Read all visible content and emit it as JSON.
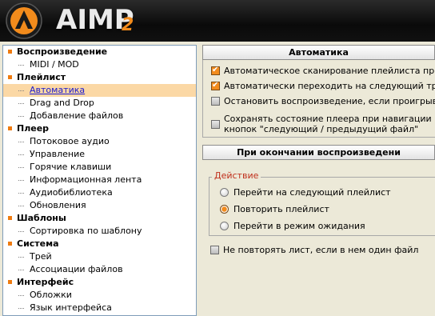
{
  "header": {
    "title": "AIMP",
    "version": "2"
  },
  "colors": {
    "accent": "#f28b1c",
    "selected_bg": "#fbd8a5",
    "header_bg": "#111111",
    "legend_text": "#c0301c"
  },
  "tree": {
    "categories": [
      {
        "label": "Воспроизведение",
        "items": [
          "MIDI / MOD"
        ]
      },
      {
        "label": "Плейлист",
        "items": [
          "Автоматика",
          "Drag and Drop",
          "Добавление файлов"
        ]
      },
      {
        "label": "Плеер",
        "items": [
          "Потоковое аудио",
          "Управление",
          "Горячие клавиши",
          "Информационная лента",
          "Аудиобиблиотека",
          "Обновления"
        ]
      },
      {
        "label": "Шаблоны",
        "items": [
          "Сортировка по шаблону"
        ]
      },
      {
        "label": "Система",
        "items": [
          "Трей",
          "Ассоциации файлов"
        ]
      },
      {
        "label": "Интерфейс",
        "items": [
          "Обложки",
          "Язык интерфейса"
        ]
      }
    ],
    "selected": "Автоматика"
  },
  "automation": {
    "header": "Автоматика",
    "options": [
      {
        "label": "Автоматическое сканирование плейлиста при добав",
        "checked": true
      },
      {
        "label": "Автоматически переходить на следующий трек",
        "checked": true
      },
      {
        "label": "Остановить воспроизведение, если проигрываемый",
        "checked": false
      },
      {
        "label": "Сохранять состояние плеера при навигации по плей",
        "label_line2": "кнопок \"следующий / предыдущий файл\"",
        "checked": false
      }
    ]
  },
  "end_of_playback": {
    "header": "При окончании воспроизведени",
    "group_label": "Действие",
    "radios": [
      {
        "label": "Перейти на следующий плейлист",
        "selected": false
      },
      {
        "label": "Повторить плейлист",
        "selected": true
      },
      {
        "label": "Перейти в режим ожидания",
        "selected": false
      }
    ],
    "no_repeat_label": "Не повторять лист, если в нем один файл",
    "no_repeat_checked": false
  }
}
